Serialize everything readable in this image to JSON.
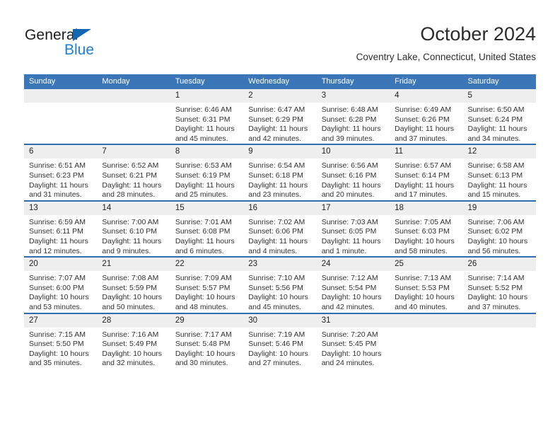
{
  "brand": {
    "word_one": "General",
    "word_two": "Blue",
    "triangle_color": "#1167b1",
    "blue_text_color": "#1e7fd4"
  },
  "header": {
    "title": "October 2024",
    "subtitle": "Coventry Lake, Connecticut, United States"
  },
  "theme": {
    "header_row_bg": "#3a76b8",
    "row_divider": "#2f6daf",
    "daynum_bg": "#eeeeee"
  },
  "weekday_headers": [
    "Sunday",
    "Monday",
    "Tuesday",
    "Wednesday",
    "Thursday",
    "Friday",
    "Saturday"
  ],
  "labels": {
    "sunrise_prefix": "Sunrise:",
    "sunset_prefix": "Sunset:",
    "daylight_prefix": "Daylight:"
  },
  "weeks": [
    [
      {
        "day": "",
        "sunrise": "",
        "sunset": "",
        "daylight": ""
      },
      {
        "day": "",
        "sunrise": "",
        "sunset": "",
        "daylight": ""
      },
      {
        "day": "1",
        "sunrise": "Sunrise: 6:46 AM",
        "sunset": "Sunset: 6:31 PM",
        "daylight": "Daylight: 11 hours and 45 minutes."
      },
      {
        "day": "2",
        "sunrise": "Sunrise: 6:47 AM",
        "sunset": "Sunset: 6:29 PM",
        "daylight": "Daylight: 11 hours and 42 minutes."
      },
      {
        "day": "3",
        "sunrise": "Sunrise: 6:48 AM",
        "sunset": "Sunset: 6:28 PM",
        "daylight": "Daylight: 11 hours and 39 minutes."
      },
      {
        "day": "4",
        "sunrise": "Sunrise: 6:49 AM",
        "sunset": "Sunset: 6:26 PM",
        "daylight": "Daylight: 11 hours and 37 minutes."
      },
      {
        "day": "5",
        "sunrise": "Sunrise: 6:50 AM",
        "sunset": "Sunset: 6:24 PM",
        "daylight": "Daylight: 11 hours and 34 minutes."
      }
    ],
    [
      {
        "day": "6",
        "sunrise": "Sunrise: 6:51 AM",
        "sunset": "Sunset: 6:23 PM",
        "daylight": "Daylight: 11 hours and 31 minutes."
      },
      {
        "day": "7",
        "sunrise": "Sunrise: 6:52 AM",
        "sunset": "Sunset: 6:21 PM",
        "daylight": "Daylight: 11 hours and 28 minutes."
      },
      {
        "day": "8",
        "sunrise": "Sunrise: 6:53 AM",
        "sunset": "Sunset: 6:19 PM",
        "daylight": "Daylight: 11 hours and 25 minutes."
      },
      {
        "day": "9",
        "sunrise": "Sunrise: 6:54 AM",
        "sunset": "Sunset: 6:18 PM",
        "daylight": "Daylight: 11 hours and 23 minutes."
      },
      {
        "day": "10",
        "sunrise": "Sunrise: 6:56 AM",
        "sunset": "Sunset: 6:16 PM",
        "daylight": "Daylight: 11 hours and 20 minutes."
      },
      {
        "day": "11",
        "sunrise": "Sunrise: 6:57 AM",
        "sunset": "Sunset: 6:14 PM",
        "daylight": "Daylight: 11 hours and 17 minutes."
      },
      {
        "day": "12",
        "sunrise": "Sunrise: 6:58 AM",
        "sunset": "Sunset: 6:13 PM",
        "daylight": "Daylight: 11 hours and 15 minutes."
      }
    ],
    [
      {
        "day": "13",
        "sunrise": "Sunrise: 6:59 AM",
        "sunset": "Sunset: 6:11 PM",
        "daylight": "Daylight: 11 hours and 12 minutes."
      },
      {
        "day": "14",
        "sunrise": "Sunrise: 7:00 AM",
        "sunset": "Sunset: 6:10 PM",
        "daylight": "Daylight: 11 hours and 9 minutes."
      },
      {
        "day": "15",
        "sunrise": "Sunrise: 7:01 AM",
        "sunset": "Sunset: 6:08 PM",
        "daylight": "Daylight: 11 hours and 6 minutes."
      },
      {
        "day": "16",
        "sunrise": "Sunrise: 7:02 AM",
        "sunset": "Sunset: 6:06 PM",
        "daylight": "Daylight: 11 hours and 4 minutes."
      },
      {
        "day": "17",
        "sunrise": "Sunrise: 7:03 AM",
        "sunset": "Sunset: 6:05 PM",
        "daylight": "Daylight: 11 hours and 1 minute."
      },
      {
        "day": "18",
        "sunrise": "Sunrise: 7:05 AM",
        "sunset": "Sunset: 6:03 PM",
        "daylight": "Daylight: 10 hours and 58 minutes."
      },
      {
        "day": "19",
        "sunrise": "Sunrise: 7:06 AM",
        "sunset": "Sunset: 6:02 PM",
        "daylight": "Daylight: 10 hours and 56 minutes."
      }
    ],
    [
      {
        "day": "20",
        "sunrise": "Sunrise: 7:07 AM",
        "sunset": "Sunset: 6:00 PM",
        "daylight": "Daylight: 10 hours and 53 minutes."
      },
      {
        "day": "21",
        "sunrise": "Sunrise: 7:08 AM",
        "sunset": "Sunset: 5:59 PM",
        "daylight": "Daylight: 10 hours and 50 minutes."
      },
      {
        "day": "22",
        "sunrise": "Sunrise: 7:09 AM",
        "sunset": "Sunset: 5:57 PM",
        "daylight": "Daylight: 10 hours and 48 minutes."
      },
      {
        "day": "23",
        "sunrise": "Sunrise: 7:10 AM",
        "sunset": "Sunset: 5:56 PM",
        "daylight": "Daylight: 10 hours and 45 minutes."
      },
      {
        "day": "24",
        "sunrise": "Sunrise: 7:12 AM",
        "sunset": "Sunset: 5:54 PM",
        "daylight": "Daylight: 10 hours and 42 minutes."
      },
      {
        "day": "25",
        "sunrise": "Sunrise: 7:13 AM",
        "sunset": "Sunset: 5:53 PM",
        "daylight": "Daylight: 10 hours and 40 minutes."
      },
      {
        "day": "26",
        "sunrise": "Sunrise: 7:14 AM",
        "sunset": "Sunset: 5:52 PM",
        "daylight": "Daylight: 10 hours and 37 minutes."
      }
    ],
    [
      {
        "day": "27",
        "sunrise": "Sunrise: 7:15 AM",
        "sunset": "Sunset: 5:50 PM",
        "daylight": "Daylight: 10 hours and 35 minutes."
      },
      {
        "day": "28",
        "sunrise": "Sunrise: 7:16 AM",
        "sunset": "Sunset: 5:49 PM",
        "daylight": "Daylight: 10 hours and 32 minutes."
      },
      {
        "day": "29",
        "sunrise": "Sunrise: 7:17 AM",
        "sunset": "Sunset: 5:48 PM",
        "daylight": "Daylight: 10 hours and 30 minutes."
      },
      {
        "day": "30",
        "sunrise": "Sunrise: 7:19 AM",
        "sunset": "Sunset: 5:46 PM",
        "daylight": "Daylight: 10 hours and 27 minutes."
      },
      {
        "day": "31",
        "sunrise": "Sunrise: 7:20 AM",
        "sunset": "Sunset: 5:45 PM",
        "daylight": "Daylight: 10 hours and 24 minutes."
      },
      {
        "day": "",
        "sunrise": "",
        "sunset": "",
        "daylight": ""
      },
      {
        "day": "",
        "sunrise": "",
        "sunset": "",
        "daylight": ""
      }
    ]
  ]
}
